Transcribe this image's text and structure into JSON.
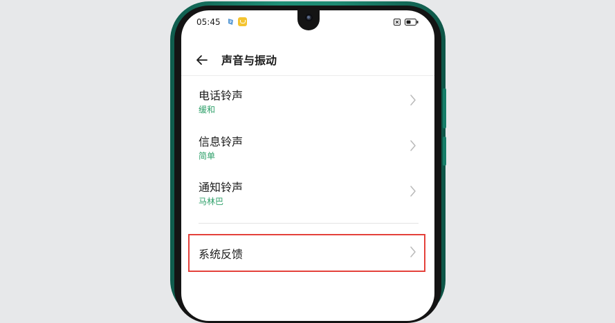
{
  "status_bar": {
    "time": "05:45",
    "icons": [
      "app-notification-icon",
      "gift-notification-icon",
      "no-sim-icon",
      "battery-icon"
    ]
  },
  "header": {
    "back_icon": "back-arrow-icon",
    "title": "声音与振动"
  },
  "ringtones": [
    {
      "label": "电话铃声",
      "value": "缓和"
    },
    {
      "label": "信息铃声",
      "value": "简单"
    },
    {
      "label": "通知铃声",
      "value": "马林巴"
    }
  ],
  "feedback": {
    "label": "系统反馈"
  },
  "colors": {
    "phone_frame": "#1e8a73",
    "value_text": "#2fa06a",
    "highlight": "#e4403a",
    "notification_badge": "#f4c430"
  }
}
